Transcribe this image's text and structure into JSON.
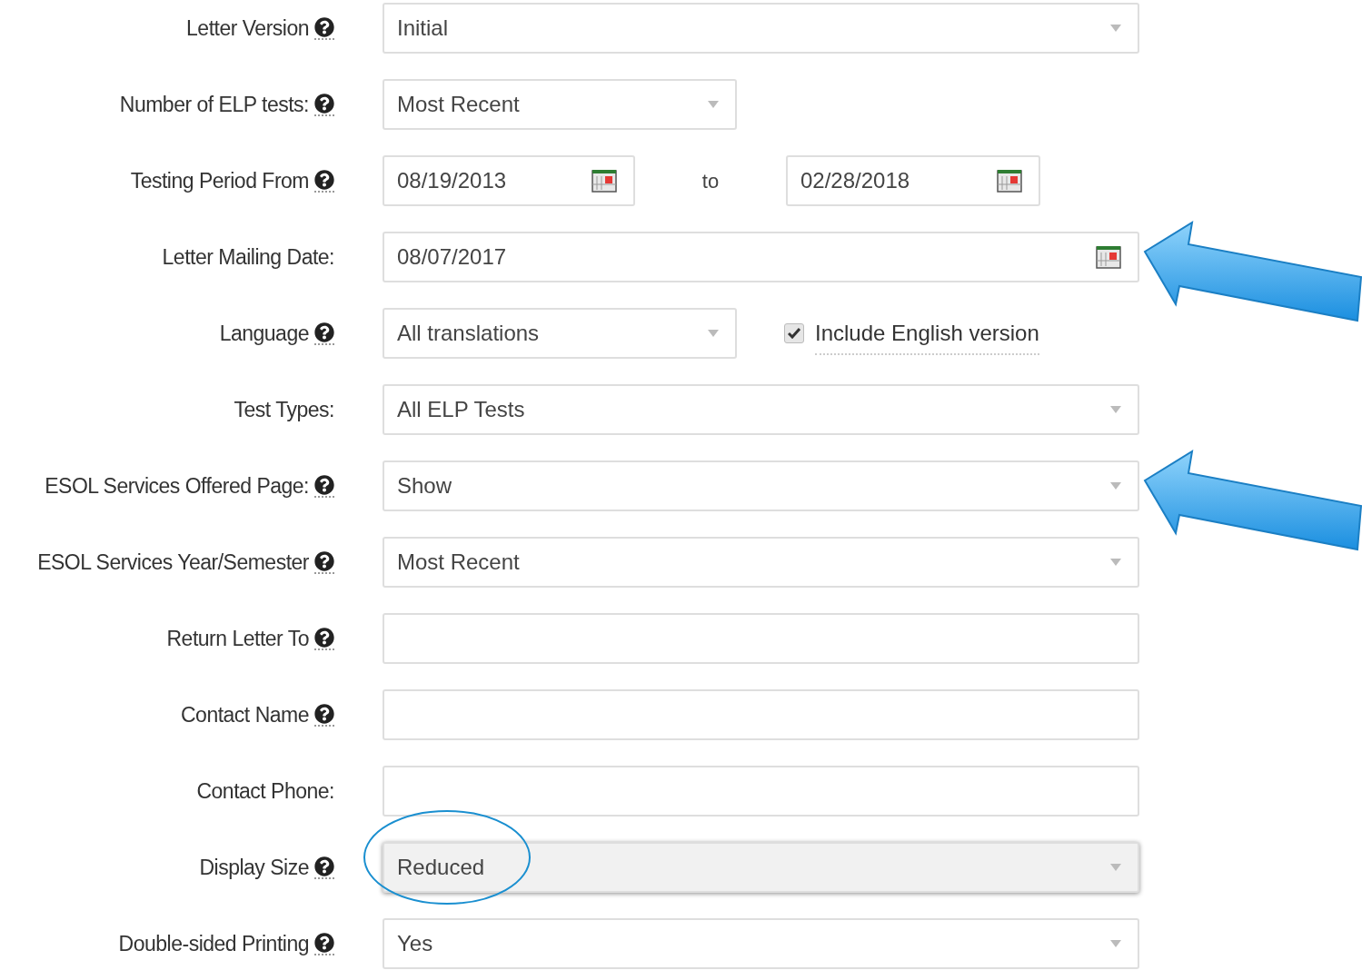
{
  "rows": [
    {
      "label": "Letter Version",
      "help": true,
      "kind": "wide-select",
      "value": "Initial"
    },
    {
      "label": "Number of ELP tests:",
      "help": true,
      "kind": "short-select",
      "value": "Most Recent"
    },
    {
      "label": "Testing Period From",
      "help": true,
      "kind": "date-range",
      "from": "08/19/2013",
      "separator": "to",
      "to": "02/28/2018"
    },
    {
      "label": "Letter Mailing Date:",
      "help": false,
      "kind": "date",
      "value": "08/07/2017",
      "arrow": true
    },
    {
      "label": "Language",
      "help": true,
      "kind": "select-check",
      "value": "All translations",
      "check_label": "Include English version",
      "checked": true
    },
    {
      "label": "Test Types:",
      "help": false,
      "kind": "wide-select",
      "value": "All ELP Tests"
    },
    {
      "label": "ESOL Services Offered Page:",
      "help": true,
      "kind": "wide-select",
      "value": "Show",
      "arrow": true
    },
    {
      "label": "ESOL Services Year/Semester",
      "help": true,
      "kind": "wide-select",
      "value": "Most Recent"
    },
    {
      "label": "Return Letter To",
      "help": true,
      "kind": "text",
      "value": ""
    },
    {
      "label": "Contact Name",
      "help": true,
      "kind": "text",
      "value": ""
    },
    {
      "label": "Contact Phone:",
      "help": false,
      "kind": "text",
      "value": ""
    },
    {
      "label": "Display Size",
      "help": true,
      "kind": "wide-select",
      "value": "Reduced",
      "focused": true,
      "circled": true
    },
    {
      "label": "Double-sided Printing",
      "help": true,
      "kind": "wide-select",
      "value": "Yes"
    }
  ]
}
